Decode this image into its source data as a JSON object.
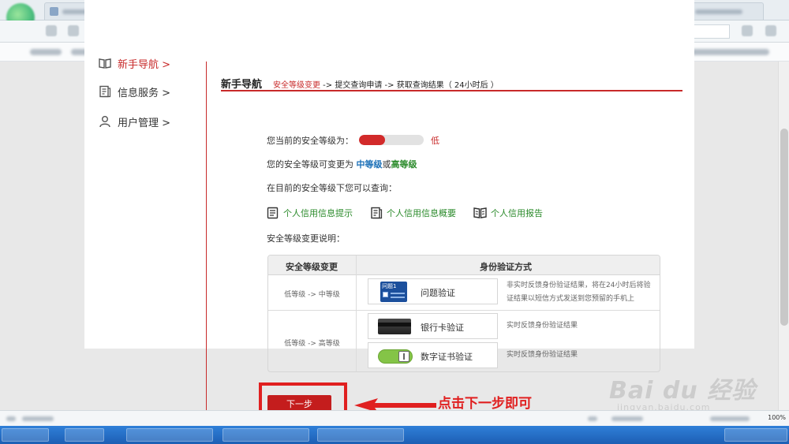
{
  "sidebar": {
    "items": [
      {
        "label": "新手导航 >"
      },
      {
        "label": "信息服务 >"
      },
      {
        "label": "用户管理 >"
      }
    ]
  },
  "main": {
    "title": "新手导航",
    "steps": {
      "step1": "安全等级变更",
      "sep1": " -> ",
      "step2": "提交查询申请",
      "sep2": " -> ",
      "step3": "获取查询结果",
      "note": "（ 24小时后 ）"
    },
    "current_level_label": "您当前的安全等级为：",
    "current_level_value": "低",
    "level_fill": 0.4,
    "change_prefix": "您的安全等级可变更为",
    "medium_level": "中等级",
    "or_word": "或",
    "high_level": "高等级",
    "query_intro": "在目前的安全等级下您可以查询：",
    "links": [
      {
        "label": "个人信用信息提示"
      },
      {
        "label": "个人信用信息概要"
      },
      {
        "label": "个人信用报告"
      }
    ],
    "explain_label": "安全等级变更说明："
  },
  "table": {
    "headers": [
      "安全等级变更",
      "身份验证方式"
    ],
    "rows": [
      {
        "level": "低等级 -> 中等级",
        "methods": [
          {
            "name": "问题验证",
            "icon_text": "问题1",
            "desc": "非实时反馈身份验证结果，将在24小时后将验证结果以短信方式发送到您预留的手机上"
          }
        ]
      },
      {
        "level": "低等级 -> 高等级",
        "methods": [
          {
            "name": "银行卡验证",
            "desc": "实时反馈身份验证结果"
          },
          {
            "name": "数字证书验证",
            "desc": "实时反馈身份验证结果"
          }
        ]
      }
    ]
  },
  "next_button": "下一步",
  "annotation": "点击下一步即可",
  "watermark": {
    "main": "Bai du 经验",
    "sub": "jingyan.baidu.com"
  },
  "status": {
    "zoom": "100%"
  },
  "colors": {
    "accent": "#c82a2a",
    "link": "#2a8a2a",
    "blue": "#1a6fb7",
    "button": "#c41d1d"
  }
}
